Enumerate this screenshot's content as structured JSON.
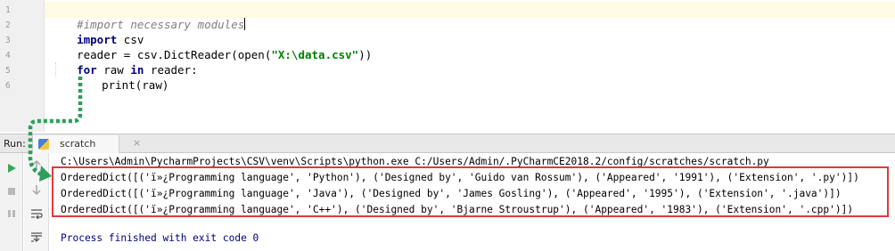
{
  "editor": {
    "line_numbers": [
      "1",
      "2",
      "3",
      "4",
      "5",
      "6"
    ],
    "lines": {
      "l1_comment": "#import necessary modules",
      "l2_kw": "import",
      "l2_rest": " csv",
      "l3_pre": "reader = csv.DictReader(open(",
      "l3_str": "\"X:\\data.csv\"",
      "l3_post": "))",
      "l4_kw1": "for",
      "l4_mid": " raw ",
      "l4_kw2": "in",
      "l4_rest": " reader:",
      "l5_call": "print",
      "l5_rest": "(raw)"
    }
  },
  "run_window": {
    "label": "Run:",
    "tab_label": "scratch",
    "tab_close": "×"
  },
  "console": {
    "command": "C:\\Users\\Admin\\PycharmProjects\\CSV\\venv\\Scripts\\python.exe C:/Users/Admin/.PyCharmCE2018.2/config/scratches/scratch.py",
    "output": [
      "OrderedDict([('ï»¿Programming language', 'Python'), ('Designed by', 'Guido van Rossum'), ('Appeared', '1991'), ('Extension', '.py')])",
      "OrderedDict([('ï»¿Programming language', 'Java'), ('Designed by', 'James Gosling'), ('Appeared', '1995'), ('Extension', '.java')])",
      "OrderedDict([('ï»¿Programming language', 'C++'), ('Designed by', 'Bjarne Stroustrup'), ('Appeared', '1983'), ('Extension', '.cpp')])"
    ],
    "exit_message": "Process finished with exit code 0"
  },
  "icons": {
    "run": "play-icon",
    "stop": "stop-icon",
    "pause": "pause-icon",
    "soft_wrap": "soft-wrap-icon",
    "scroll_end": "scroll-to-end-icon",
    "up": "up-arrow-icon",
    "down": "down-arrow-icon"
  },
  "colors": {
    "highlight_box": "#e0393b",
    "annotation_arrow": "#2e9e5b",
    "keyword": "#000080",
    "string": "#008000",
    "comment": "#808080"
  }
}
